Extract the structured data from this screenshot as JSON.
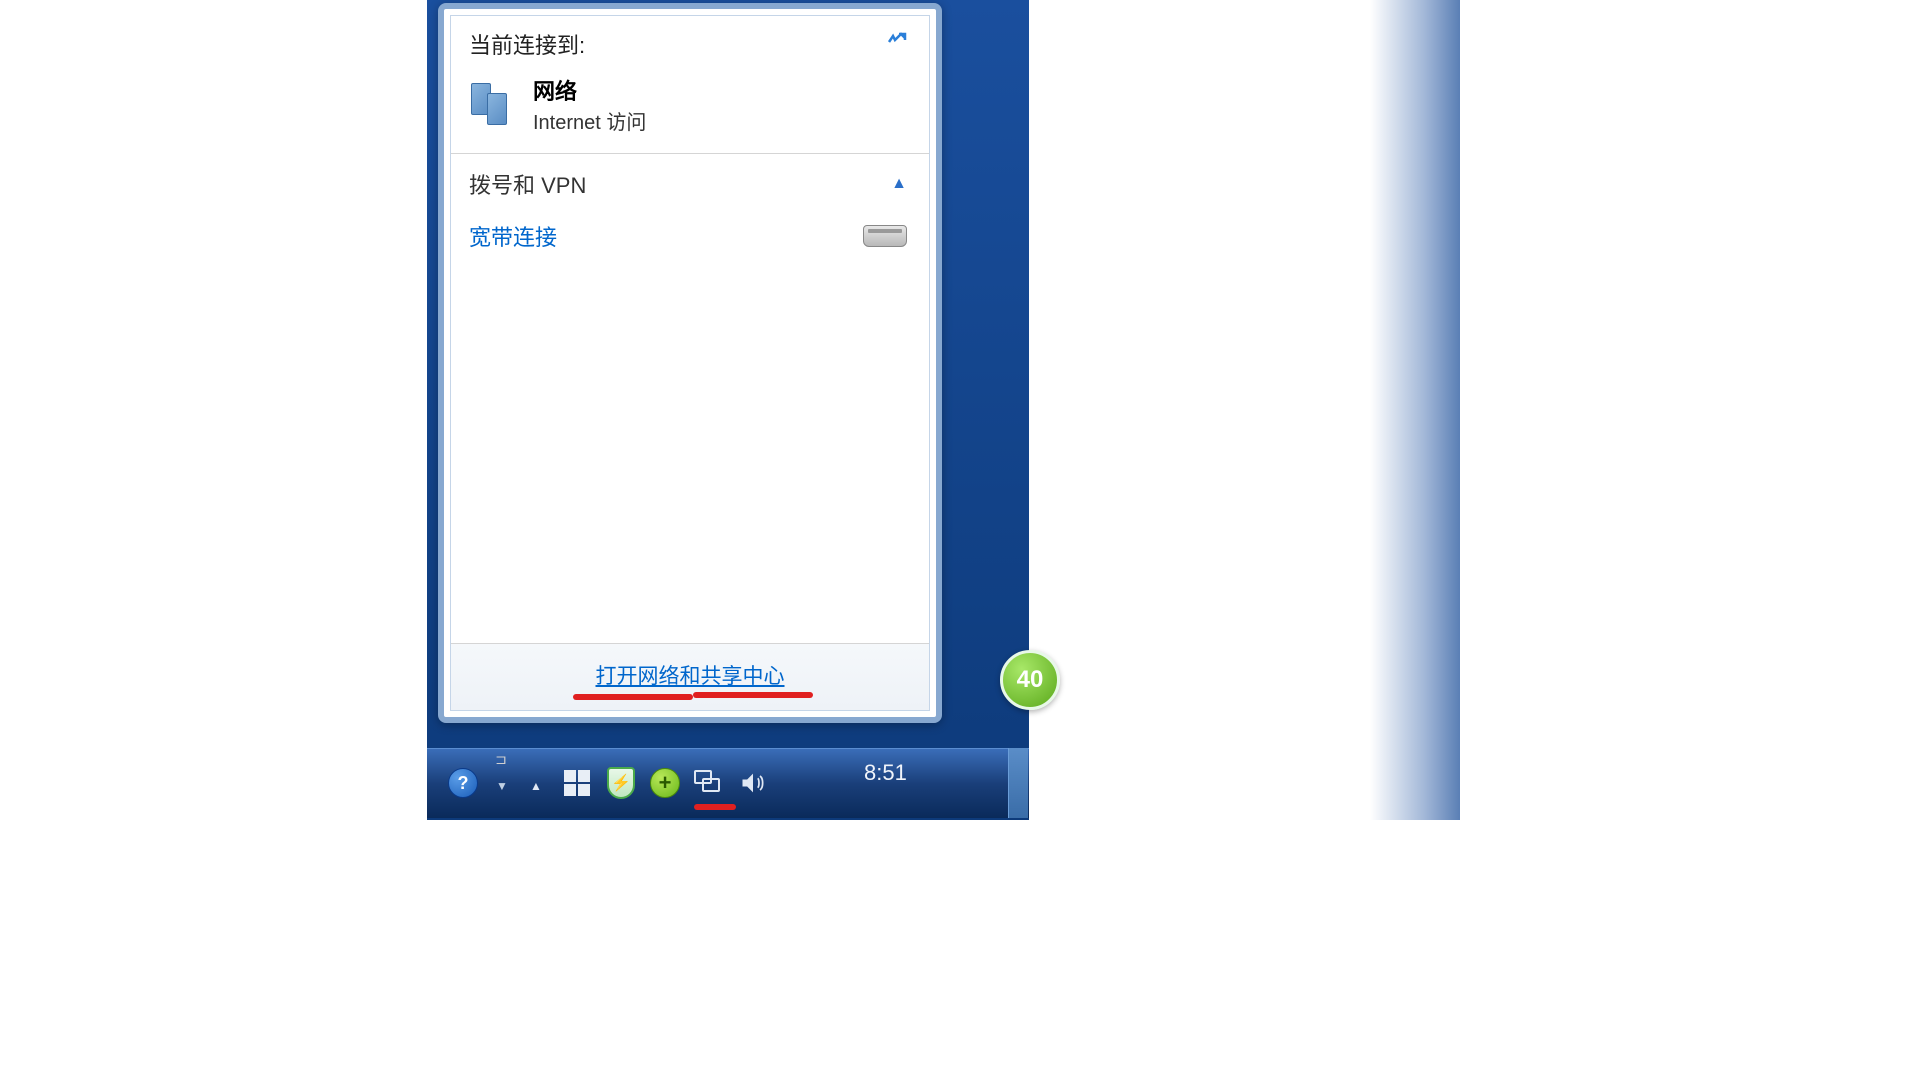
{
  "popup": {
    "header_title": "当前连接到:",
    "current_network": {
      "name": "网络",
      "status": "Internet 访问"
    },
    "section": {
      "title": "拨号和 VPN"
    },
    "connections": [
      {
        "name": "宽带连接"
      }
    ],
    "footer_link": "打开网络和共享中心"
  },
  "taskbar": {
    "clock": "8:51"
  },
  "floating_badge": "40"
}
